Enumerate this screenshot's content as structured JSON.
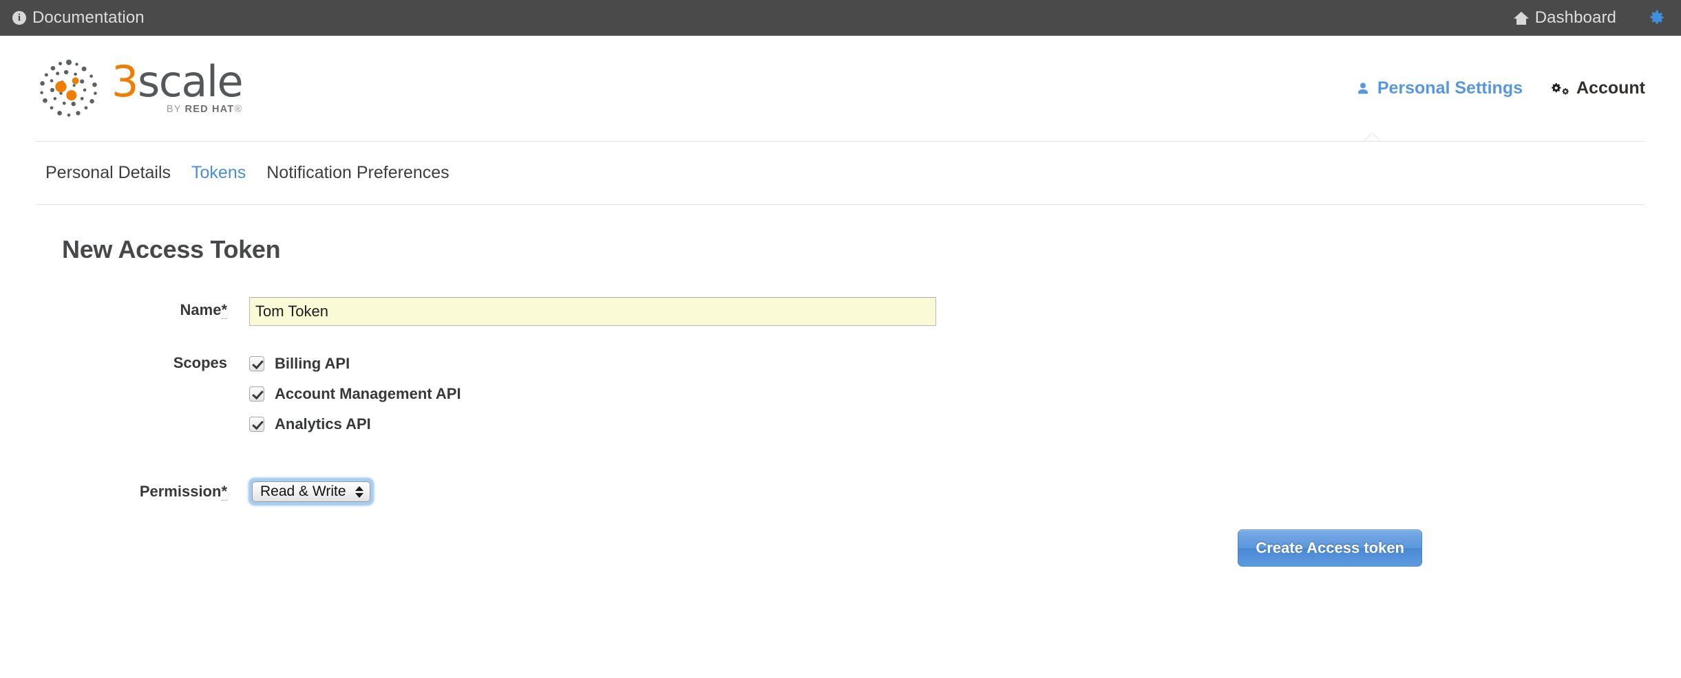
{
  "topbar": {
    "documentation_label": "Documentation",
    "documentation_icon": "info-circle-icon",
    "dashboard_label": "Dashboard",
    "dashboard_icon": "home-icon",
    "settings_icon": "gear-icon",
    "background_color": "#4a4a4a",
    "accent_color": "#3f8fdc"
  },
  "brand": {
    "logo_mark": "3scale-dots-icon",
    "name_number": "3",
    "name_rest": "scale",
    "tagline_prefix": "BY ",
    "tagline_brand": "RED HAT",
    "tagline_suffix": "®",
    "orange": "#ef7d00",
    "gray": "#55585b"
  },
  "account_nav": {
    "items": [
      {
        "label": "Personal Settings",
        "icon": "user-icon",
        "active": true
      },
      {
        "label": "Account",
        "icon": "cogs-icon",
        "active": false
      }
    ]
  },
  "tabs": [
    {
      "label": "Personal Details",
      "active": false
    },
    {
      "label": "Tokens",
      "active": true
    },
    {
      "label": "Notification Preferences",
      "active": false
    }
  ],
  "form": {
    "title": "New Access Token",
    "name": {
      "label": "Name",
      "required_mark": "*",
      "value": "Tom Token",
      "placeholder": ""
    },
    "scopes": {
      "label": "Scopes",
      "options": [
        {
          "label": "Billing API",
          "checked": true
        },
        {
          "label": "Account Management API",
          "checked": true
        },
        {
          "label": "Analytics API",
          "checked": true
        }
      ]
    },
    "permission": {
      "label": "Permission",
      "required_mark": "*",
      "selected": "Read & Write"
    },
    "submit_label": "Create Access token"
  }
}
